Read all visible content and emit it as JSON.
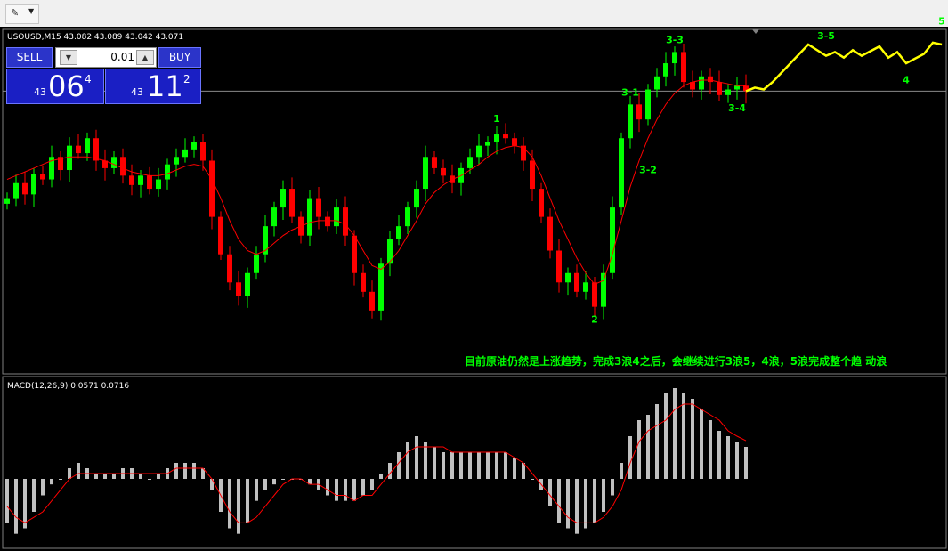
{
  "toolbar": {
    "icon": "draw-tools-icon"
  },
  "header": {
    "symbol_line": "USOUSD,M15  43.082 43.089 43.042 43.071"
  },
  "trade_panel": {
    "sell_label": "SELL",
    "buy_label": "BUY",
    "lot_value": "0.01",
    "sell_quote": {
      "prefix": "43",
      "big": "06",
      "sup": "4"
    },
    "buy_quote": {
      "prefix": "43",
      "big": "11",
      "sup": "2"
    }
  },
  "annotation_text": "目前原油仍然是上涨趋势，完成3浪4之后，会继续进行3浪5，4浪，5浪完成整个趋 动浪",
  "macd_label": "MACD(12,26,9) 0.0571 0.0716",
  "colors": {
    "bull": "#00ff00",
    "bear": "#ff0000",
    "ma": "#ff0000",
    "projection": "#ffff00",
    "wave_label": "#00ff00",
    "histogram": "#c0c0c0",
    "signal": "#ff0000"
  },
  "chart_data": {
    "type": "candlestick",
    "symbol": "USOUSD",
    "timeframe": "M15",
    "price_range": [
      41.6,
      43.32
    ],
    "current_price": 43.071,
    "closes": [
      42.5,
      42.58,
      42.52,
      42.63,
      42.6,
      42.72,
      42.65,
      42.78,
      42.74,
      42.82,
      42.7,
      42.66,
      42.72,
      42.62,
      42.57,
      42.62,
      42.55,
      42.6,
      42.68,
      42.72,
      42.76,
      42.8,
      42.7,
      42.4,
      42.2,
      42.05,
      41.98,
      42.1,
      42.2,
      42.35,
      42.45,
      42.55,
      42.4,
      42.3,
      42.5,
      42.4,
      42.35,
      42.45,
      42.3,
      42.1,
      42.0,
      41.9,
      42.15,
      42.28,
      42.35,
      42.45,
      42.55,
      42.72,
      42.66,
      42.62,
      42.58,
      42.66,
      42.72,
      42.78,
      42.8,
      42.84,
      42.82,
      42.78,
      42.7,
      42.55,
      42.4,
      42.22,
      42.05,
      42.1,
      42.0,
      42.05,
      41.92,
      42.1,
      42.45,
      42.82,
      43.0,
      42.92,
      43.08,
      43.15,
      43.22,
      43.28,
      43.12,
      43.08,
      43.15,
      43.12,
      43.05,
      43.08,
      43.1,
      43.071
    ],
    "ma_values": [
      42.6,
      42.62,
      42.64,
      42.66,
      42.68,
      42.7,
      42.71,
      42.72,
      42.72,
      42.72,
      42.71,
      42.7,
      42.68,
      42.66,
      42.64,
      42.63,
      42.62,
      42.62,
      42.63,
      42.65,
      42.67,
      42.68,
      42.67,
      42.6,
      42.5,
      42.38,
      42.28,
      42.22,
      42.2,
      42.22,
      42.26,
      42.3,
      42.33,
      42.35,
      42.37,
      42.38,
      42.38,
      42.38,
      42.36,
      42.3,
      42.22,
      42.14,
      42.12,
      42.16,
      42.22,
      42.3,
      42.38,
      42.47,
      42.53,
      42.57,
      42.6,
      42.62,
      42.65,
      42.68,
      42.72,
      42.75,
      42.77,
      42.78,
      42.77,
      42.72,
      42.62,
      42.5,
      42.38,
      42.28,
      42.18,
      42.1,
      42.04,
      42.06,
      42.2,
      42.38,
      42.56,
      42.7,
      42.82,
      42.92,
      43.0,
      43.06,
      43.1,
      43.12,
      43.13,
      43.13,
      43.12,
      43.11,
      43.1,
      43.1
    ],
    "wave_labels": [
      {
        "label": "1",
        "index": 55,
        "price": 42.86,
        "position": "above"
      },
      {
        "label": "2",
        "index": 66,
        "price": 41.92,
        "position": "below"
      },
      {
        "label": "3-1",
        "index": 70,
        "price": 43.0,
        "position": "above"
      },
      {
        "label": "3-2",
        "index": 72,
        "price": 42.72,
        "position": "below"
      },
      {
        "label": "3-3",
        "index": 75,
        "price": 43.28,
        "position": "above"
      },
      {
        "label": "3-4",
        "index": 82,
        "price": 43.05,
        "position": "below"
      },
      {
        "label": "3-5",
        "index": 92,
        "price": 43.3,
        "position": "above"
      },
      {
        "label": "4",
        "index": 101,
        "price": 43.2,
        "position": "below"
      },
      {
        "label": "5",
        "index": 105,
        "price": 43.38,
        "position": "above"
      }
    ],
    "projection": [
      [
        83,
        43.071
      ],
      [
        84,
        43.09
      ],
      [
        85,
        43.08
      ],
      [
        86,
        43.12
      ],
      [
        90,
        43.32
      ],
      [
        92,
        43.26
      ],
      [
        93,
        43.28
      ],
      [
        94,
        43.25
      ],
      [
        95,
        43.29
      ],
      [
        96,
        43.26
      ],
      [
        98,
        43.31
      ],
      [
        99,
        43.25
      ],
      [
        100,
        43.28
      ],
      [
        101,
        43.22
      ],
      [
        103,
        43.27
      ],
      [
        104,
        43.33
      ],
      [
        105,
        43.32
      ]
    ],
    "macd": {
      "label": "MACD(12,26,9)",
      "main": 0.0571,
      "signal_value": 0.0716,
      "histogram": [
        -0.08,
        -0.1,
        -0.09,
        -0.06,
        -0.03,
        -0.01,
        0.0,
        0.02,
        0.03,
        0.02,
        0.01,
        0.01,
        0.01,
        0.02,
        0.02,
        0.01,
        0.0,
        0.01,
        0.02,
        0.03,
        0.03,
        0.03,
        0.02,
        -0.02,
        -0.06,
        -0.09,
        -0.1,
        -0.08,
        -0.04,
        -0.02,
        -0.01,
        0.0,
        0.0,
        0.0,
        -0.01,
        -0.02,
        -0.03,
        -0.04,
        -0.04,
        -0.04,
        -0.03,
        -0.02,
        0.01,
        0.03,
        0.05,
        0.07,
        0.08,
        0.07,
        0.06,
        0.05,
        0.05,
        0.05,
        0.05,
        0.05,
        0.05,
        0.05,
        0.05,
        0.04,
        0.03,
        0.0,
        -0.02,
        -0.05,
        -0.08,
        -0.09,
        -0.1,
        -0.09,
        -0.08,
        -0.06,
        -0.03,
        0.03,
        0.08,
        0.11,
        0.12,
        0.14,
        0.16,
        0.17,
        0.16,
        0.15,
        0.13,
        0.11,
        0.09,
        0.08,
        0.07,
        0.06
      ],
      "signal": [
        -0.05,
        -0.07,
        -0.08,
        -0.07,
        -0.06,
        -0.04,
        -0.02,
        0.0,
        0.01,
        0.01,
        0.01,
        0.01,
        0.01,
        0.01,
        0.01,
        0.01,
        0.01,
        0.01,
        0.01,
        0.02,
        0.02,
        0.02,
        0.02,
        0.0,
        -0.03,
        -0.06,
        -0.08,
        -0.08,
        -0.07,
        -0.05,
        -0.03,
        -0.01,
        0.0,
        0.0,
        -0.01,
        -0.01,
        -0.02,
        -0.03,
        -0.03,
        -0.04,
        -0.03,
        -0.03,
        -0.01,
        0.01,
        0.03,
        0.05,
        0.06,
        0.06,
        0.06,
        0.06,
        0.05,
        0.05,
        0.05,
        0.05,
        0.05,
        0.05,
        0.05,
        0.04,
        0.03,
        0.01,
        -0.01,
        -0.03,
        -0.05,
        -0.07,
        -0.08,
        -0.08,
        -0.08,
        -0.07,
        -0.05,
        -0.02,
        0.03,
        0.07,
        0.09,
        0.1,
        0.11,
        0.13,
        0.14,
        0.14,
        0.13,
        0.12,
        0.11,
        0.09,
        0.08,
        0.0716
      ],
      "range": [
        -0.12,
        0.18
      ]
    }
  }
}
